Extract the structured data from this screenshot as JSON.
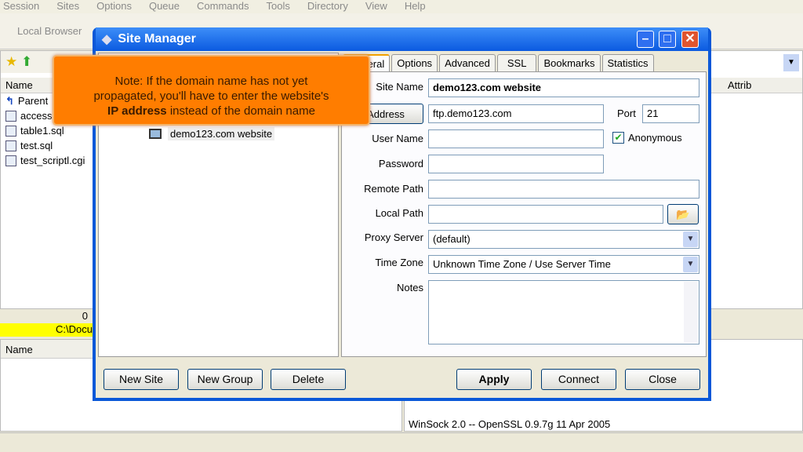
{
  "menu": [
    "Session",
    "Sites",
    "Options",
    "Queue",
    "Commands",
    "Tools",
    "Directory",
    "View",
    "Help"
  ],
  "local_browser_label": "Local Browser",
  "left_pane": {
    "header": "Name",
    "files": [
      "Parent",
      "access",
      "table1.sql",
      "test.sql",
      "test_scriptl.cgi"
    ],
    "count": "0",
    "path": "C:\\Docu",
    "lower_header": "Name"
  },
  "right_pane": {
    "header_attrib": "Attrib",
    "log_line": "WinSock 2.0 -- OpenSSL 0.9.7g 11 Apr 2005"
  },
  "dialog": {
    "title": "Site Manager",
    "tree_item": "demo123.com website",
    "tabs": [
      "General",
      "Options",
      "Advanced",
      "SSL",
      "Bookmarks",
      "Statistics"
    ],
    "fields": {
      "site_name_label": "Site Name",
      "site_name": "demo123.com website",
      "address_label": "Address",
      "address": "ftp.demo123.com",
      "port_label": "Port",
      "port": "21",
      "user_name_label": "User Name",
      "user_name": "",
      "anonymous_label": "Anonymous",
      "anonymous_checked": true,
      "password_label": "Password",
      "password": "",
      "remote_path_label": "Remote Path",
      "remote_path": "",
      "local_path_label": "Local Path",
      "local_path": "",
      "proxy_label": "Proxy Server",
      "proxy": "(default)",
      "timezone_label": "Time Zone",
      "timezone": "Unknown Time Zone / Use Server Time",
      "notes_label": "Notes",
      "notes": ""
    },
    "buttons": {
      "new_site": "New Site",
      "new_group": "New Group",
      "delete": "Delete",
      "apply": "Apply",
      "connect": "Connect",
      "close": "Close"
    }
  },
  "note": {
    "line1": "Note: If the domain name has not yet",
    "line2": "propagated, you'll have to enter the website's",
    "bold": "IP address",
    "line3": " instead of the domain name"
  },
  "colors": {
    "note_bg": "#ff7d00",
    "titlebar": "#0a58d8",
    "path_highlight": "#ffff00"
  }
}
